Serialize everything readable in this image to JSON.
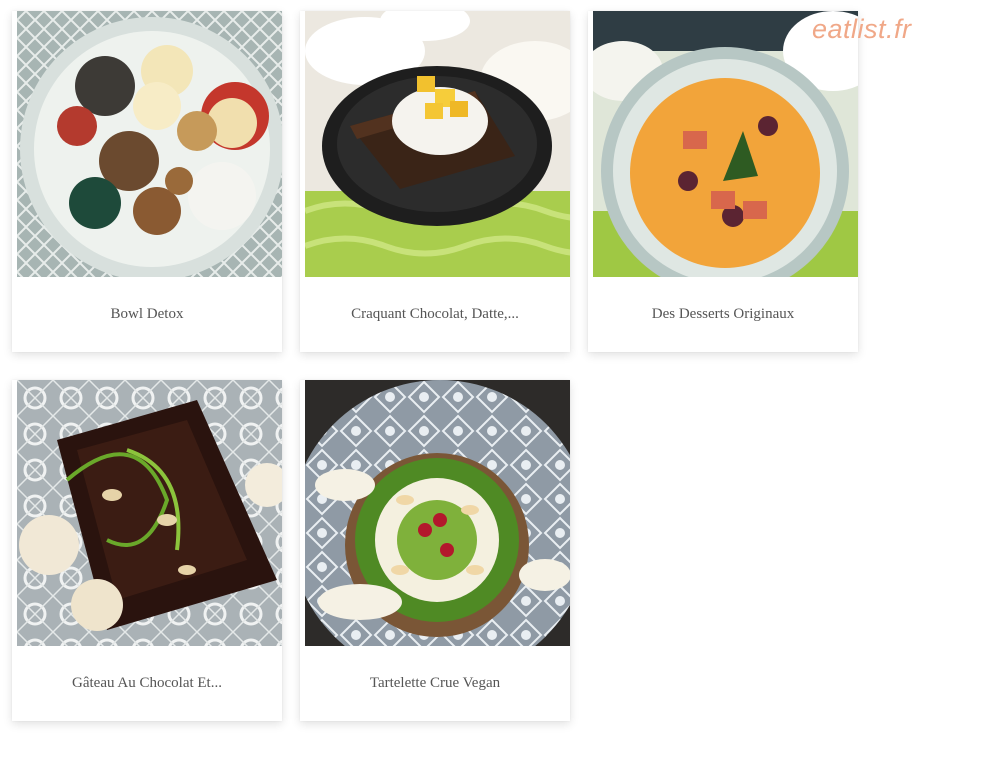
{
  "watermark": "eatlist.fr",
  "cards": [
    {
      "title": "Bowl Detox",
      "image": "bowl detox photo"
    },
    {
      "title": "Craquant Chocolat, Datte,...",
      "image": "chocolate date slice photo"
    },
    {
      "title": "Des Desserts Originaux",
      "image": "orange soup photo"
    },
    {
      "title": "Gâteau Au Chocolat Et...",
      "image": "chocolate cake photo"
    },
    {
      "title": "Tartelette Crue Vegan",
      "image": "raw vegan tartlet photo"
    }
  ]
}
